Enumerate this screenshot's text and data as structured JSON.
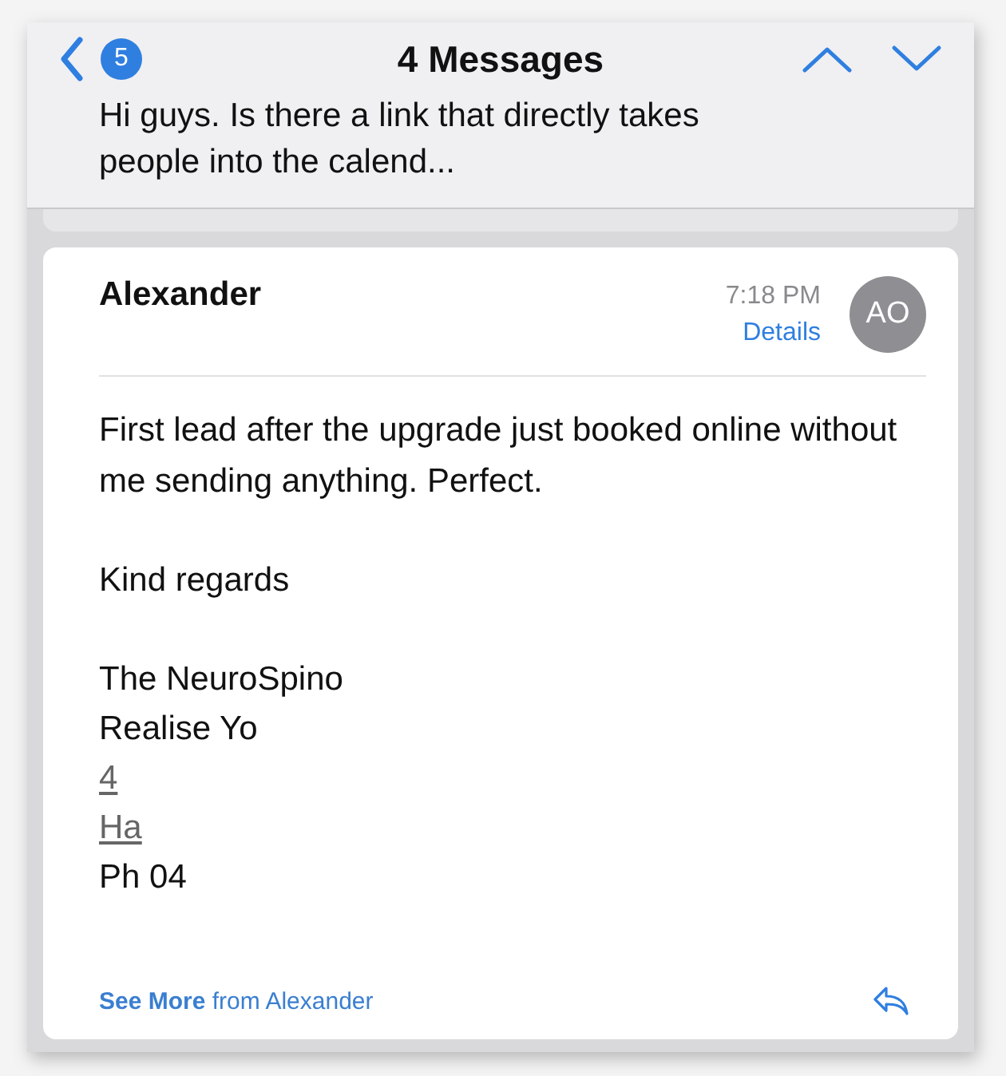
{
  "header": {
    "badge": "5",
    "title": "4 Messages",
    "preview": "Hi guys. Is there a link that directly takes people into the calend..."
  },
  "message": {
    "sender": "Alexander",
    "time": "7:18 PM",
    "details": "Details",
    "avatar": "AO",
    "body": [
      "First lead after the upgrade just booked online without me sending anything. Perfect.",
      "Kind regards"
    ],
    "signature": [
      {
        "text": "The NeuroSpino",
        "underlined": false
      },
      {
        "text": "Realise Yo",
        "underlined": false
      },
      {
        "text": "4",
        "underlined": true
      },
      {
        "text": "Ha",
        "underlined": true
      },
      {
        "text": "Ph 04",
        "underlined": false
      }
    ],
    "footer": "**See More** from Alexander"
  }
}
